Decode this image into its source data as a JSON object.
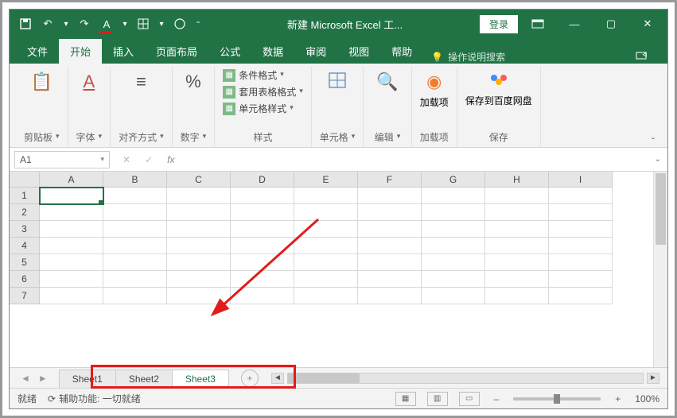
{
  "title": "新建 Microsoft Excel 工...",
  "login_label": "登录",
  "tabs": {
    "file": "文件",
    "home": "开始",
    "insert": "插入",
    "layout": "页面布局",
    "formulas": "公式",
    "data": "数据",
    "review": "审阅",
    "view": "视图",
    "help": "帮助"
  },
  "tell_me": "操作说明搜索",
  "ribbon": {
    "clipboard": "剪贴板",
    "font": "字体",
    "alignment": "对齐方式",
    "number": "数字",
    "styles": "样式",
    "cond_fmt": "条件格式",
    "tbl_fmt": "套用表格格式",
    "cell_fmt": "单元格样式",
    "cells": "单元格",
    "editing": "编辑",
    "addins": "加载项",
    "addins_btn": "加载项",
    "save_group": "保存",
    "save_baidu": "保存到百度网盘"
  },
  "namebox": "A1",
  "columns": [
    "A",
    "B",
    "C",
    "D",
    "E",
    "F",
    "G",
    "H",
    "I"
  ],
  "rows": [
    "1",
    "2",
    "3",
    "4",
    "5",
    "6",
    "7"
  ],
  "sheets": [
    "Sheet1",
    "Sheet2",
    "Sheet3"
  ],
  "active_sheet_index": 2,
  "status": {
    "ready": "就绪",
    "accessibility": "辅助功能: 一切就绪",
    "zoom": "100%"
  }
}
